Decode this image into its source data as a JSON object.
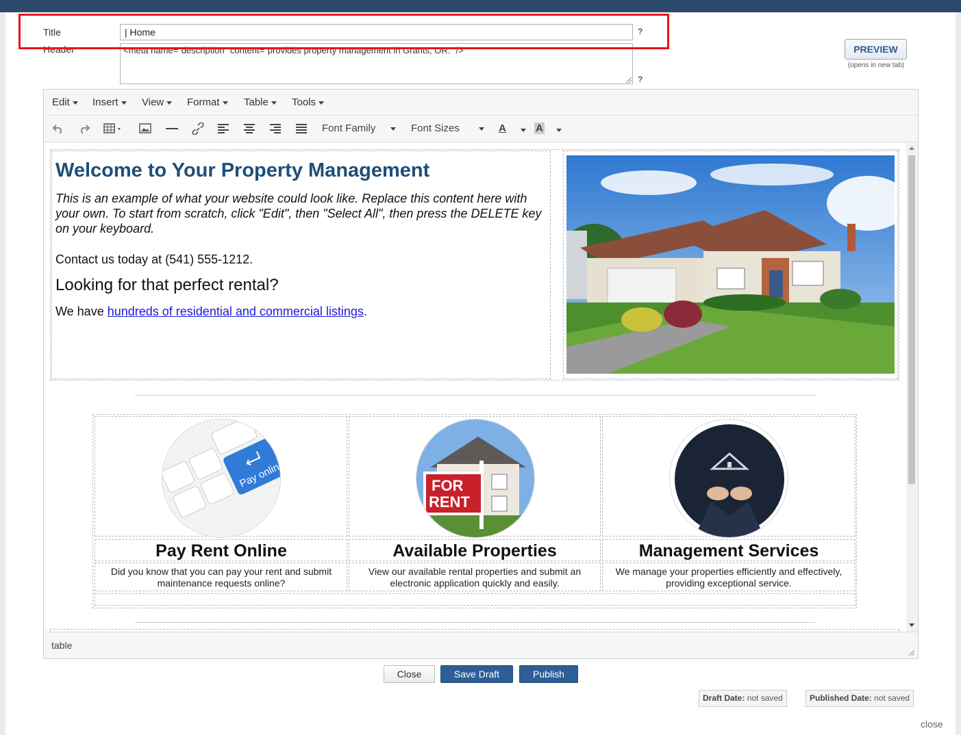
{
  "form": {
    "title_label": "Title",
    "title_value": "| Home",
    "header_label": "Header",
    "header_value": "<meta name=\"description\" content=\"provides property management in Grants, OR.\" />",
    "help_glyph": "?"
  },
  "preview": {
    "label": "PREVIEW",
    "note": "(opens in new tab)"
  },
  "editor": {
    "menus": [
      "Edit",
      "Insert",
      "View",
      "Format",
      "Table",
      "Tools"
    ],
    "font_family": "Font Family",
    "font_sizes": "Font Sizes",
    "text_color_glyph": "A",
    "bg_color_glyph": "A",
    "status_path": "table"
  },
  "content": {
    "heading": "Welcome to Your Property Management",
    "intro": "This is an example of what your website could look like. Replace this content here with your own. To start from scratch, click \"Edit\", then \"Select All\", then press the DELETE key on your keyboard.",
    "contact": "Contact us today at (541) 555-1212.",
    "subheading": "Looking for that perfect rental?",
    "listings_prefix": "We have ",
    "listings_link": "hundreds of residential and commercial listings",
    "listings_suffix": ".",
    "features": [
      {
        "title": "Pay Rent Online",
        "desc": "Did you know that you can pay your rent and submit maintenance requests online?",
        "image_text": "Pay online"
      },
      {
        "title": "Available Properties",
        "desc": "View our available rental properties and submit an electronic application quickly and easily.",
        "image_text": "FOR RENT"
      },
      {
        "title": "Management Services",
        "desc": "We manage your properties efficiently and effectively, providing exceptional service."
      }
    ]
  },
  "actions": {
    "close": "Close",
    "save_draft": "Save Draft",
    "publish": "Publish"
  },
  "dates": {
    "draft_label": "Draft Date:",
    "draft_value": "not saved",
    "published_label": "Published Date:",
    "published_value": "not saved"
  },
  "footer": {
    "close_link": "close"
  },
  "colors": {
    "primary": "#2d5e96",
    "heading": "#1e4e79",
    "highlight": "#e8141b",
    "link": "#1a1ad8"
  }
}
